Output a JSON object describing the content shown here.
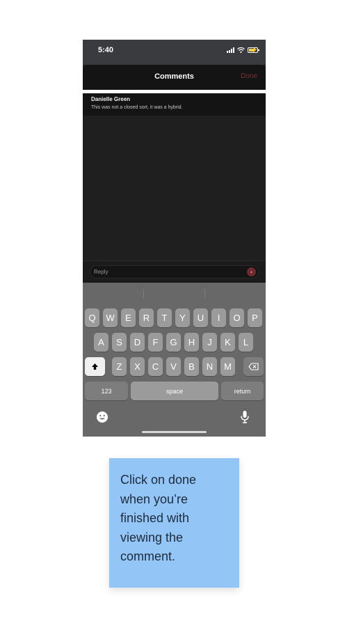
{
  "status_bar": {
    "time": "5:40",
    "icons": [
      "signal-icon",
      "wifi-icon",
      "battery-charging-icon"
    ]
  },
  "header": {
    "title": "Comments",
    "done_label": "Done"
  },
  "comment": {
    "author": "Danielle Green",
    "text": "This was not a closed sort, it was a hybrid."
  },
  "reply": {
    "placeholder": "Reply",
    "send_icon": "send-arrow-icon"
  },
  "keyboard": {
    "row1": [
      "Q",
      "W",
      "E",
      "R",
      "T",
      "Y",
      "U",
      "I",
      "O",
      "P"
    ],
    "row2": [
      "A",
      "S",
      "D",
      "F",
      "G",
      "H",
      "J",
      "K",
      "L"
    ],
    "row3": [
      "Z",
      "X",
      "C",
      "V",
      "B",
      "N",
      "M"
    ],
    "numbers_label": "123",
    "space_label": "space",
    "return_label": "return",
    "icons": [
      "shift-icon",
      "backspace-icon",
      "emoji-icon",
      "microphone-icon"
    ]
  },
  "note": {
    "text": "Click on done when you’re finished with viewing the comment."
  },
  "colors": {
    "accent_done": "#7a2e33",
    "note_bg": "#93c5f7",
    "keyboard_bg": "#686868"
  }
}
